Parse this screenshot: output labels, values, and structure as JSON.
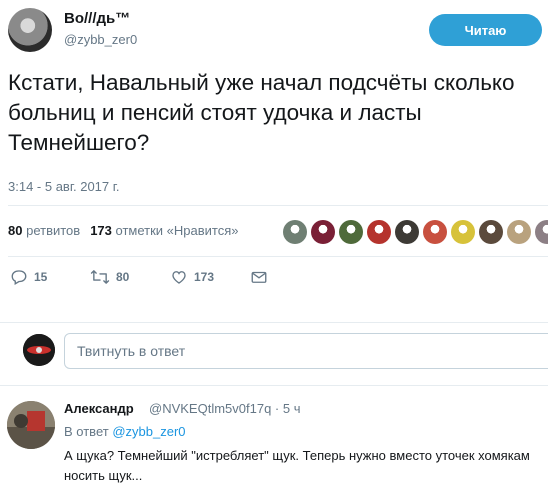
{
  "author": {
    "display_name": "Bo///дь™",
    "handle": "@zybb_zer0"
  },
  "follow_button": {
    "label": "Читаю",
    "color": "#2fa0d6"
  },
  "tweet": {
    "text": "Кстати, Навальный уже начал подсчёты сколько больниц и пенсий стоят удочка и ласты Темнейшего?",
    "timestamp": "3:14 - 5 авг. 2017 г."
  },
  "stats": {
    "retweets_count": "80",
    "retweets_label": "ретвитов",
    "likes_count": "173",
    "likes_label": "отметки «Нравится»"
  },
  "likers": [
    {
      "icon": "liker-avatar-1",
      "color": "#6f7f73"
    },
    {
      "icon": "liker-avatar-2",
      "color": "#7a2036"
    },
    {
      "icon": "liker-avatar-3",
      "color": "#4f6a3a"
    },
    {
      "icon": "liker-avatar-4",
      "color": "#b5332d"
    },
    {
      "icon": "liker-avatar-5",
      "color": "#3d3a35"
    },
    {
      "icon": "liker-avatar-6",
      "color": "#c8503f"
    },
    {
      "icon": "liker-avatar-7",
      "color": "#d7c23a"
    },
    {
      "icon": "liker-avatar-8",
      "color": "#5b4a3c"
    },
    {
      "icon": "liker-avatar-9",
      "color": "#b9a27e"
    },
    {
      "icon": "liker-avatar-10",
      "color": "#8c7f85"
    }
  ],
  "actions": {
    "reply_count": "15",
    "retweet_count": "80",
    "like_count": "173"
  },
  "reply_box": {
    "placeholder": "Твитнуть в ответ"
  },
  "reply": {
    "name": "Александр",
    "handle": "@NVKEQtlm5v0f17q · 5 ч",
    "in_reply_prefix": "В ответ",
    "in_reply_handle": "@zybb_zer0",
    "text": "А щука? Темнейший \"истребляет\" щук. Теперь нужно вместо уточек хомякам носить щук..."
  },
  "colors": {
    "accent": "#2fa0d6",
    "muted": "#657786",
    "link": "#1b95e0",
    "divider": "#e6ecf0"
  }
}
